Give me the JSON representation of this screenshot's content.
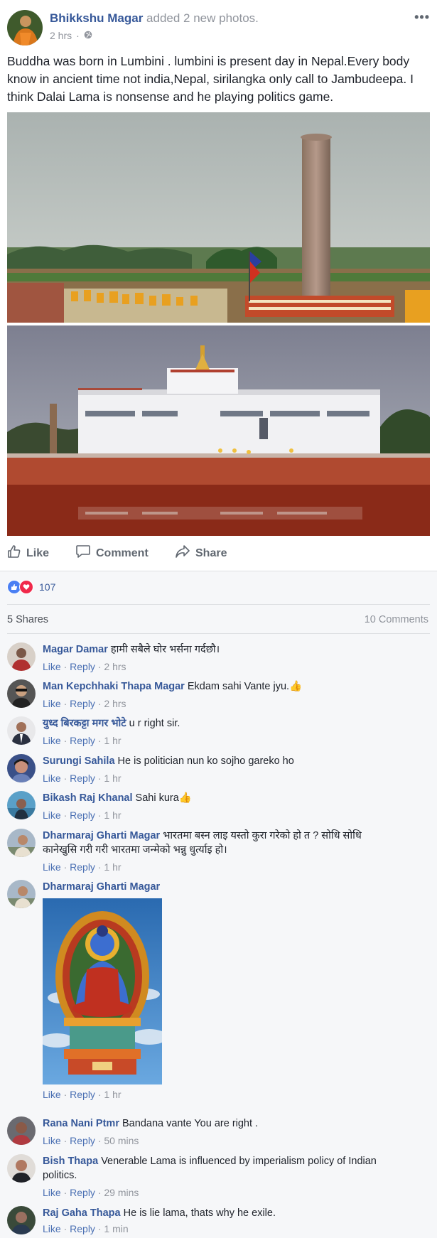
{
  "post": {
    "author": "Bhikkshu Magar",
    "action": "added 2 new photos.",
    "time": "2 hrs",
    "text": "Buddha was born in Lumbini . lumbini is present day in Nepal.Every body know in ancient time not india,Nepal, sirilangka only call to Jambudeepa. I think Dalai Lama is nonsense and he playing politics game.",
    "privacy_icon": "globe-icon"
  },
  "actions": {
    "like": "Like",
    "comment": "Comment",
    "share": "Share"
  },
  "reactions": {
    "count": "107",
    "types": [
      "like",
      "love"
    ]
  },
  "stats": {
    "shares": "5 Shares",
    "comments": "10 Comments"
  },
  "comment_actions": {
    "like": "Like",
    "reply": "Reply",
    "sep": "·"
  },
  "comments": [
    {
      "name": "Magar Damar",
      "text": "हामी सबैले घोर भर्सना गर्दछौ।",
      "time": "2 hrs"
    },
    {
      "name": "Man Kepchhaki Thapa Magar",
      "text": "Ekdam sahi Vante jyu.",
      "emoji": "👍",
      "time": "2 hrs"
    },
    {
      "name": "युध्द बिरकट्टा मगर भोटे",
      "text": "u r right sir.",
      "time": "1 hr"
    },
    {
      "name": "Surungi Sahila",
      "text": "He is politician nun ko sojho gareko ho",
      "time": "1 hr"
    },
    {
      "name": "Bikash Raj Khanal",
      "text": "Sahi kura",
      "emoji": "👍",
      "time": "1 hr"
    },
    {
      "name": "Dharmaraj Gharti Magar",
      "text": "भारतमा बस्न लाइ यस्तो कुरा गरेको हो त ? सोधि सोधि कानेखुसि गरी गरी भारतमा जन्मेको भन्नु धुर्त्याइ हो।",
      "time": "1 hr"
    },
    {
      "name": "Dharmaraj Gharti Magar",
      "text": "",
      "photo": "buddha-image",
      "time": "1 hr"
    },
    {
      "name": "Rana Nani Ptmr",
      "text": "Bandana vante You are right .",
      "time": "50 mins"
    },
    {
      "name": "Bish Thapa",
      "text": "Venerable Lama is influenced by imperialism policy of Indian politics.",
      "time": "29 mins"
    },
    {
      "name": "Raj Gaha Thapa",
      "text": "He is lie lama, thats why he exile.",
      "time": "1 min"
    }
  ]
}
